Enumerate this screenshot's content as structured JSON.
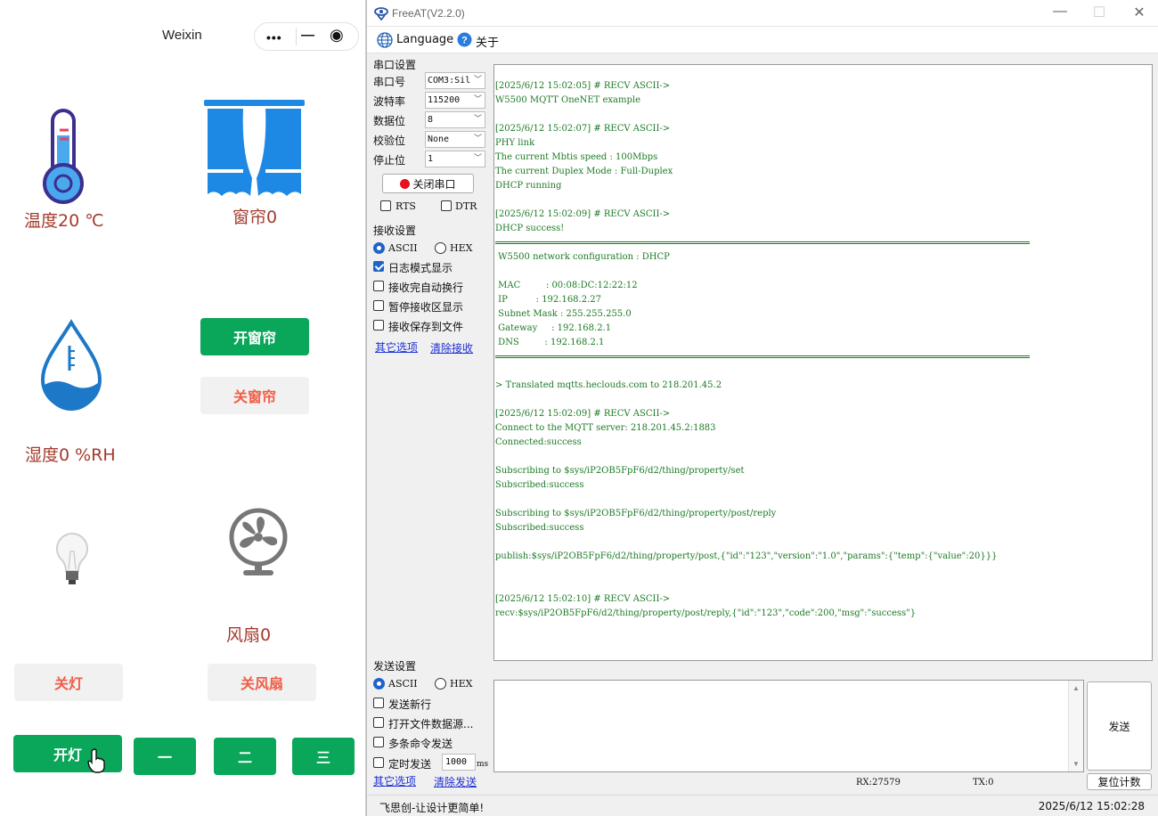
{
  "weixin": {
    "title": "Weixin",
    "capsule": {
      "more": "•••",
      "minimize": "—",
      "close": "◉"
    },
    "temperature_label": "温度20 ℃",
    "curtain_label": "窗帘0",
    "humidity_label": "湿度0 %RH",
    "fan_label": "风扇0",
    "buttons": {
      "open_curtain": "开窗帘",
      "close_curtain": "关窗帘",
      "light_off": "关灯",
      "fan_off": "关风扇",
      "light_on": "开灯",
      "level1": "一",
      "level2": "二",
      "level3": "三"
    },
    "colors": {
      "green": "#0aa65a",
      "red_text": "#f05d47",
      "label": "#a43a2c"
    }
  },
  "freeat": {
    "title": "FreeAT(V2.2.0)",
    "window_controls": {
      "minimize": "—",
      "maximize": "☐",
      "close": "✕"
    },
    "menu": {
      "language": "Language",
      "about": "关于"
    },
    "serial": {
      "header": "串口设置",
      "port_label": "串口号",
      "port_value": "COM3:Sil",
      "baud_label": "波特率",
      "baud_value": "115200",
      "databits_label": "数据位",
      "databits_value": "8",
      "parity_label": "校验位",
      "parity_value": "None",
      "stopbits_label": "停止位",
      "stopbits_value": "1",
      "close_port": "关闭串口",
      "rts": "RTS",
      "dtr": "DTR"
    },
    "receive": {
      "header": "接收设置",
      "ascii": "ASCII",
      "hex": "HEX",
      "log_mode": "日志模式显示",
      "auto_newline": "接收完自动换行",
      "pause_display": "暂停接收区显示",
      "save_to_file": "接收保存到文件",
      "other_options": "其它选项",
      "clear_receive": "清除接收"
    },
    "terminal_lines": [
      {
        "t": "[2025/6/12 15:02:05] # RECV ASCII->"
      },
      {
        "t": "W5500 MQTT OneNET example"
      },
      {
        "t": ""
      },
      {
        "t": "[2025/6/12 15:02:07] # RECV ASCII->"
      },
      {
        "t": "PHY link"
      },
      {
        "t": "The current Mbtis speed : 100Mbps"
      },
      {
        "t": "The current Duplex Mode : Full-Duplex"
      },
      {
        "t": "DHCP running"
      },
      {
        "t": ""
      },
      {
        "t": "[2025/6/12 15:02:09] # RECV ASCII->"
      },
      {
        "t": "DHCP success!"
      },
      {
        "t": "",
        "rule": true
      },
      {
        "t": " W5500 network configuration : DHCP"
      },
      {
        "t": ""
      },
      {
        "t": " MAC         : 00:08:DC:12:22:12"
      },
      {
        "t": " IP          : 192.168.2.27"
      },
      {
        "t": " Subnet Mask : 255.255.255.0"
      },
      {
        "t": " Gateway     : 192.168.2.1"
      },
      {
        "t": " DNS         : 192.168.2.1"
      },
      {
        "t": "",
        "rule": true
      },
      {
        "t": ""
      },
      {
        "t": "> Translated mqtts.heclouds.com to 218.201.45.2"
      },
      {
        "t": ""
      },
      {
        "t": "[2025/6/12 15:02:09] # RECV ASCII->"
      },
      {
        "t": "Connect to the MQTT server: 218.201.45.2:1883"
      },
      {
        "t": "Connected:success"
      },
      {
        "t": ""
      },
      {
        "t": "Subscribing to $sys/iP2OB5FpF6/d2/thing/property/set"
      },
      {
        "t": "Subscribed:success"
      },
      {
        "t": ""
      },
      {
        "t": "Subscribing to $sys/iP2OB5FpF6/d2/thing/property/post/reply"
      },
      {
        "t": "Subscribed:success"
      },
      {
        "t": ""
      },
      {
        "t": "publish:$sys/iP2OB5FpF6/d2/thing/property/post,{\"id\":\"123\",\"version\":\"1.0\",\"params\":{\"temp\":{\"value\":20}}}"
      },
      {
        "t": ""
      },
      {
        "t": ""
      },
      {
        "t": "[2025/6/12 15:02:10] # RECV ASCII->"
      },
      {
        "t": "recv:$sys/iP2OB5FpF6/d2/thing/property/post/reply,{\"id\":\"123\",\"code\":200,\"msg\":\"success\"}"
      }
    ],
    "send": {
      "header": "发送设置",
      "ascii": "ASCII",
      "hex": "HEX",
      "send_newline": "发送新行",
      "open_file": "打开文件数据源...",
      "multi_command": "多条命令发送",
      "timed_send": "定时发送",
      "interval": "1000",
      "interval_unit": "ms",
      "other_options": "其它选项",
      "clear_send": "清除发送",
      "send_button": "发送",
      "reset_count": "复位计数"
    },
    "stats": {
      "rx": "RX:27579",
      "tx": "TX:0"
    },
    "status": {
      "slogan": "飞思创-让设计更简单!",
      "time": "2025/6/12 15:02:28"
    }
  }
}
